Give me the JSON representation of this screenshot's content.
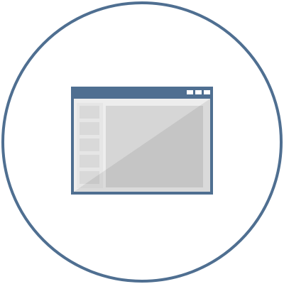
{
  "icon": {
    "name": "application-window-icon",
    "border_color": "#4f6f91",
    "title_bar_color": "#4f6f91",
    "title_bar_buttons_color": "#ffffff",
    "window_frame_color": "#ededed",
    "sidebar_item_color": "#dadada",
    "content_pane_color": "#d4d4d4",
    "content_shadow_color": "#c4c4c4",
    "title_bar_button_count": 3,
    "sidebar_item_count": 5
  }
}
